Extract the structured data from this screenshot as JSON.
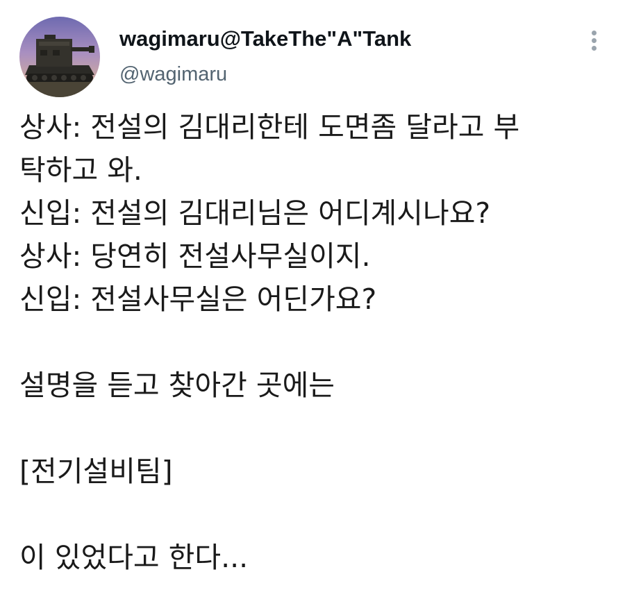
{
  "tweet": {
    "author": {
      "display_name": "wagimaru@TakeThe\"A\"Tank",
      "handle": "@wagimaru",
      "avatar_icon": "tank-avatar-icon"
    },
    "more_icon": "more-vertical-icon",
    "lines": [
      "상사: 전설의 김대리한테 도면좀 달라고 부",
      "탁하고 와.",
      "신입: 전설의 김대리님은 어디계시나요?",
      "상사: 당연히 전설사무실이지.",
      "신입: 전설사무실은 어딘가요?",
      "",
      "설명을 듣고 찾아간 곳에는",
      "",
      "[전기설비팀]",
      "",
      "이 있었다고 한다..."
    ]
  },
  "colors": {
    "text": "#1a1a1a",
    "name": "#0f1419",
    "handle": "#536471",
    "background": "#ffffff"
  }
}
